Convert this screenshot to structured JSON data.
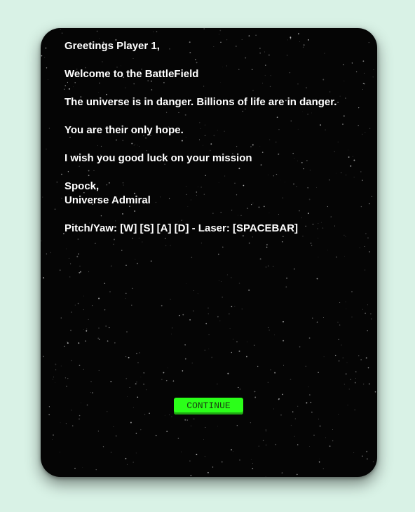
{
  "message": {
    "greeting": "Greetings Player 1,",
    "welcome": "Welcome to the BattleField",
    "danger": "The universe is in danger. Billions of life are in danger.",
    "hope": "You are their only hope.",
    "luck": "I wish you good luck on your mission",
    "signature_name": "Spock,",
    "signature_title": "Universe Admiral",
    "controls": "Pitch/Yaw: [W] [S] [A] [D] - Laser: [SPACEBAR]"
  },
  "continue_button": {
    "label": "CONTINUE"
  },
  "colors": {
    "page_background": "#d9f2e6",
    "card_background": "#050505",
    "button_green": "#2bff19"
  }
}
